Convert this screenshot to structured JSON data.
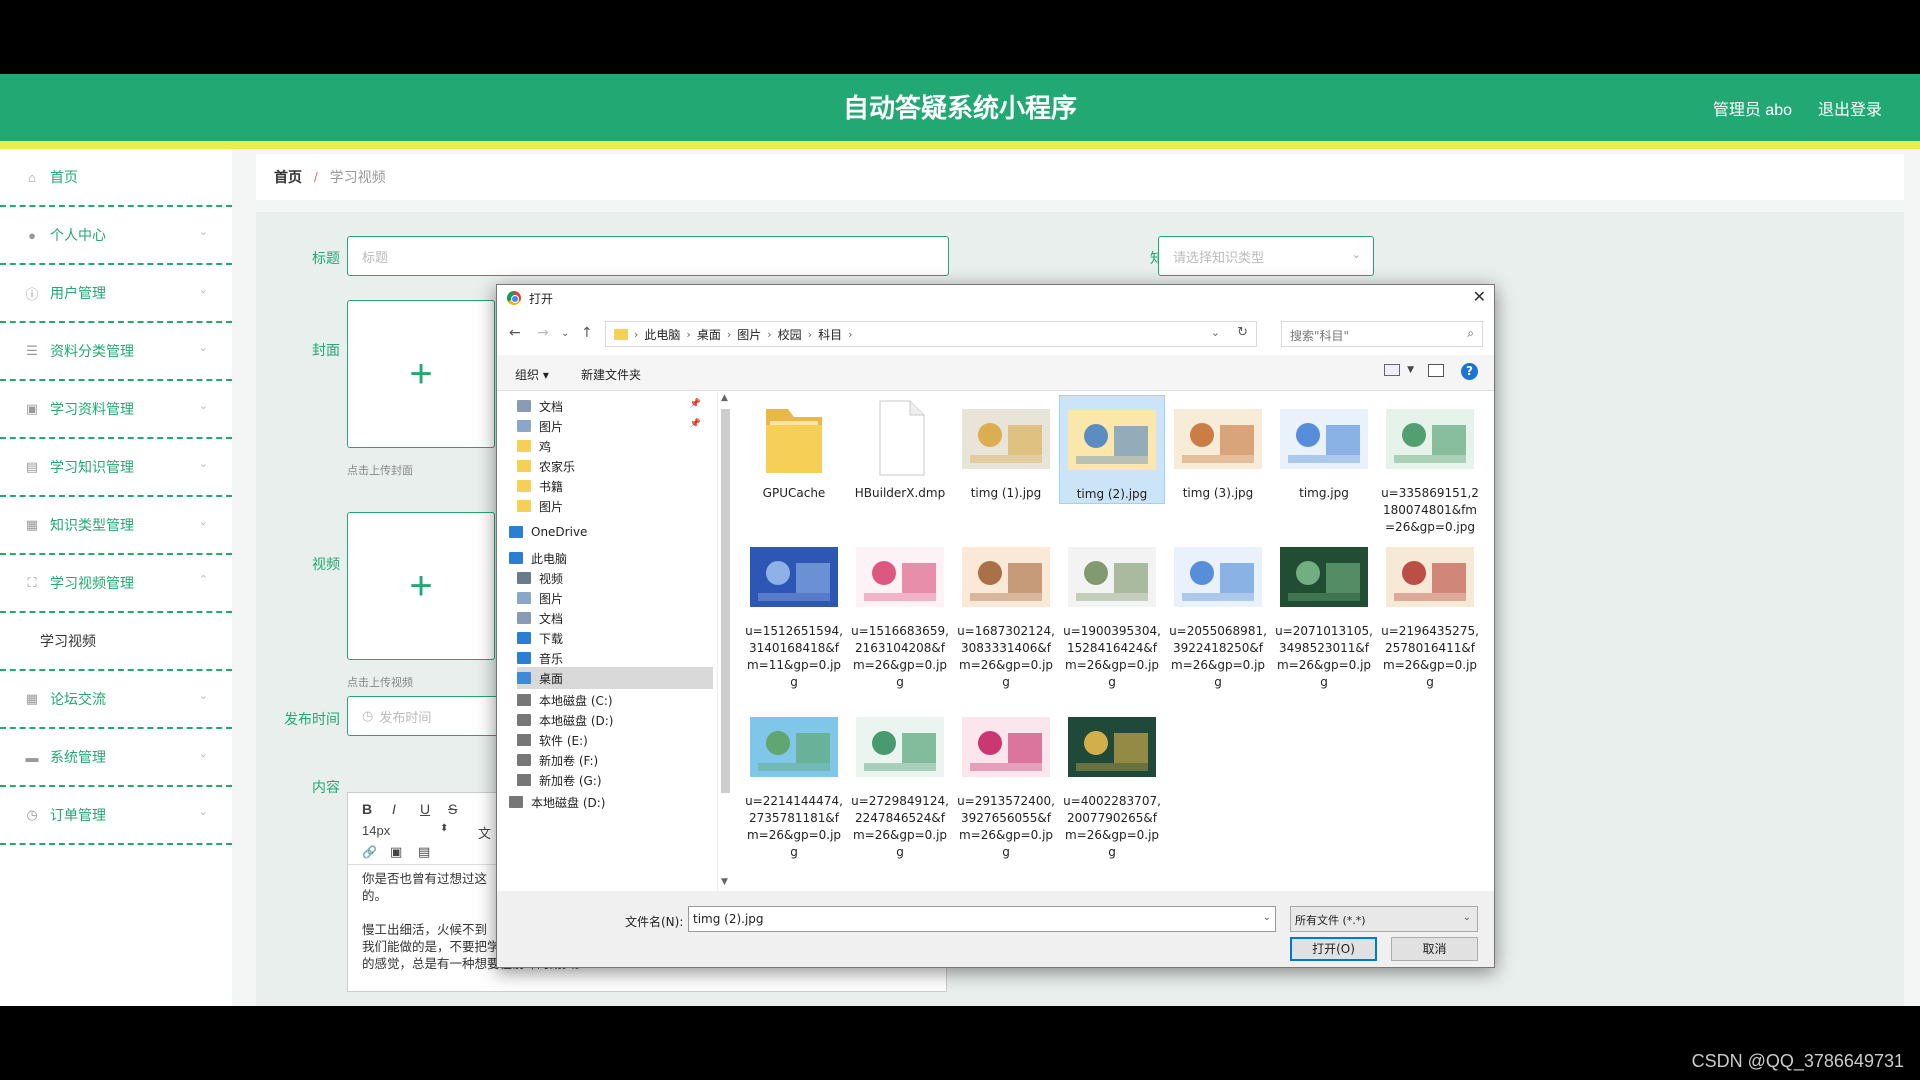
{
  "header": {
    "title": "自动答疑系统小程序",
    "admin": "管理员 abo",
    "logout": "退出登录"
  },
  "sidebar": {
    "items": [
      {
        "label": "首页",
        "icon": "home-icon"
      },
      {
        "label": "个人中心",
        "icon": "user-icon"
      },
      {
        "label": "用户管理",
        "icon": "info-icon"
      },
      {
        "label": "资料分类管理",
        "icon": "list-icon"
      },
      {
        "label": "学习资料管理",
        "icon": "doc-icon"
      },
      {
        "label": "学习知识管理",
        "icon": "chat-icon"
      },
      {
        "label": "知识类型管理",
        "icon": "grid-icon"
      },
      {
        "label": "学习视频管理",
        "icon": "fullscreen-icon"
      },
      {
        "label": "论坛交流",
        "icon": "grid-icon"
      },
      {
        "label": "系统管理",
        "icon": "briefcase-icon"
      },
      {
        "label": "订单管理",
        "icon": "clock-icon"
      }
    ],
    "sub_video": "学习视频"
  },
  "breadcrumb": {
    "home": "首页",
    "sep": "/",
    "current": "学习视频"
  },
  "form": {
    "title_label": "标题",
    "title_placeholder": "标题",
    "type_label": "知识类型",
    "type_placeholder": "请选择知识类型",
    "cover_label": "封面",
    "cover_hint": "点击上传封面",
    "video_label": "视频",
    "video_hint": "点击上传视频",
    "time_label": "发布时间",
    "time_placeholder": "发布时间",
    "content_label": "内容",
    "plus": "+"
  },
  "editor": {
    "bold": "B",
    "italic": "I",
    "underline": "U",
    "strike": "S",
    "font_size": "14px",
    "text_tool": "文",
    "paragraphs": [
      "你是否也曾有过想过这",
      "的。",
      "",
      "慢工出细活，火候不到",
      "我们能做的是，不要把学习当作一种负担。我们可以把学习当成一种乐趣去学，有那种时间不够用",
      "的感觉，总是有一种想要往前冲的劲头。"
    ]
  },
  "dialog": {
    "title": "打开",
    "close": "✕",
    "path": [
      "此电脑",
      "桌面",
      "图片",
      "校园",
      "科目"
    ],
    "search_placeholder": "搜索\"科目\"",
    "organize": "组织 ▾",
    "new_folder": "新建文件夹",
    "help": "?",
    "tree": [
      {
        "label": "文档",
        "color": "#8a9bb5",
        "pinned": true
      },
      {
        "label": "图片",
        "color": "#8aa7c9",
        "pinned": true
      },
      {
        "label": "鸡",
        "color": "#f6cf57"
      },
      {
        "label": "农家乐",
        "color": "#f6cf57"
      },
      {
        "label": "书籍",
        "color": "#f6cf57"
      },
      {
        "label": "图片",
        "color": "#f6cf57"
      },
      {
        "label": "OneDrive",
        "color": "#2a7fd4"
      },
      {
        "label": "此电脑",
        "color": "#2a7fd4"
      },
      {
        "label": "视频",
        "color": "#6b7b8e"
      },
      {
        "label": "图片",
        "color": "#8aa7c9"
      },
      {
        "label": "文档",
        "color": "#8a9bb5"
      },
      {
        "label": "下载",
        "color": "#2a7fd4"
      },
      {
        "label": "音乐",
        "color": "#2a7fd4"
      },
      {
        "label": "桌面",
        "color": "#3c8ad8",
        "selected": true
      },
      {
        "label": "本地磁盘 (C:)",
        "color": "#777"
      },
      {
        "label": "本地磁盘 (D:)",
        "color": "#777"
      },
      {
        "label": "软件 (E:)",
        "color": "#777"
      },
      {
        "label": "新加卷 (F:)",
        "color": "#777"
      },
      {
        "label": "新加卷 (G:)",
        "color": "#777"
      },
      {
        "label": "本地磁盘 (D:)",
        "color": "#777"
      }
    ],
    "files": [
      {
        "name": "GPUCache",
        "kind": "folder"
      },
      {
        "name": "HBuilderX.dmp",
        "kind": "blank"
      },
      {
        "name": "timg (1).jpg",
        "kind": "img",
        "c1": "#e9e4d8",
        "c2": "#d7a43a"
      },
      {
        "name": "timg (2).jpg",
        "kind": "img",
        "c1": "#fbe7a9",
        "c2": "#3e7cc6",
        "selected": true
      },
      {
        "name": "timg (3).jpg",
        "kind": "img",
        "c1": "#f7ecd7",
        "c2": "#c36a2d"
      },
      {
        "name": "timg.jpg",
        "kind": "img",
        "c1": "#e9f1fb",
        "c2": "#3d7dd3"
      },
      {
        "name": "u=335869151,2180074801&fm=26&gp=0.jpg",
        "kind": "img",
        "c1": "#e6f3ea",
        "c2": "#3a8f5d"
      },
      {
        "name": "u=1512651594,3140168418&fm=11&gp=0.jpg",
        "kind": "img",
        "c1": "#2e57b5",
        "c2": "#9fc1ef"
      },
      {
        "name": "u=1516683659,2163104208&fm=26&gp=0.jpg",
        "kind": "img",
        "c1": "#fdf3f7",
        "c2": "#d63c6c"
      },
      {
        "name": "u=1687302124,3083331406&fm=26&gp=0.jpg",
        "kind": "img",
        "c1": "#fbe9d8",
        "c2": "#9b5b2e"
      },
      {
        "name": "u=1900395304,1528416424&fm=26&gp=0.jpg",
        "kind": "img",
        "c1": "#f3f3f3",
        "c2": "#6e8a58"
      },
      {
        "name": "u=2055068981,3922418250&fm=26&gp=0.jpg",
        "kind": "img",
        "c1": "#e9f1fb",
        "c2": "#3d7dd3"
      },
      {
        "name": "u=2071013105,3498523011&fm=26&gp=0.jpg",
        "kind": "img",
        "c1": "#214e32",
        "c2": "#7fbf8f"
      },
      {
        "name": "u=2196435275,2578016411&fm=26&gp=0.jpg",
        "kind": "img",
        "c1": "#f6ead6",
        "c2": "#b0332b"
      },
      {
        "name": "u=2214144474,2735781181&fm=26&gp=0.jpg",
        "kind": "img",
        "c1": "#7fc6e8",
        "c2": "#5aa05a"
      },
      {
        "name": "u=2729849124,2247846524&fm=26&gp=0.jpg",
        "kind": "img",
        "c1": "#eaf5ef",
        "c2": "#2d8a5a"
      },
      {
        "name": "u=2913572400,3927656055&fm=26&gp=0.jpg",
        "kind": "img",
        "c1": "#fbe6ee",
        "c2": "#c2185b"
      },
      {
        "name": "u=4002283707,2007790265&fm=26&gp=0.jpg",
        "kind": "img",
        "c1": "#1f4a3a",
        "c2": "#f2c14e"
      }
    ],
    "filename_label": "文件名(N):",
    "filename_value": "timg (2).jpg",
    "filetype": "所有文件 (*.*)",
    "open_button": "打开(O)",
    "cancel_button": "取消"
  },
  "watermark": "CSDN @QQ_3786649731",
  "colors": {
    "accent": "#22a873",
    "highlight": "#e7ef4c",
    "select": "#cce4f7"
  }
}
